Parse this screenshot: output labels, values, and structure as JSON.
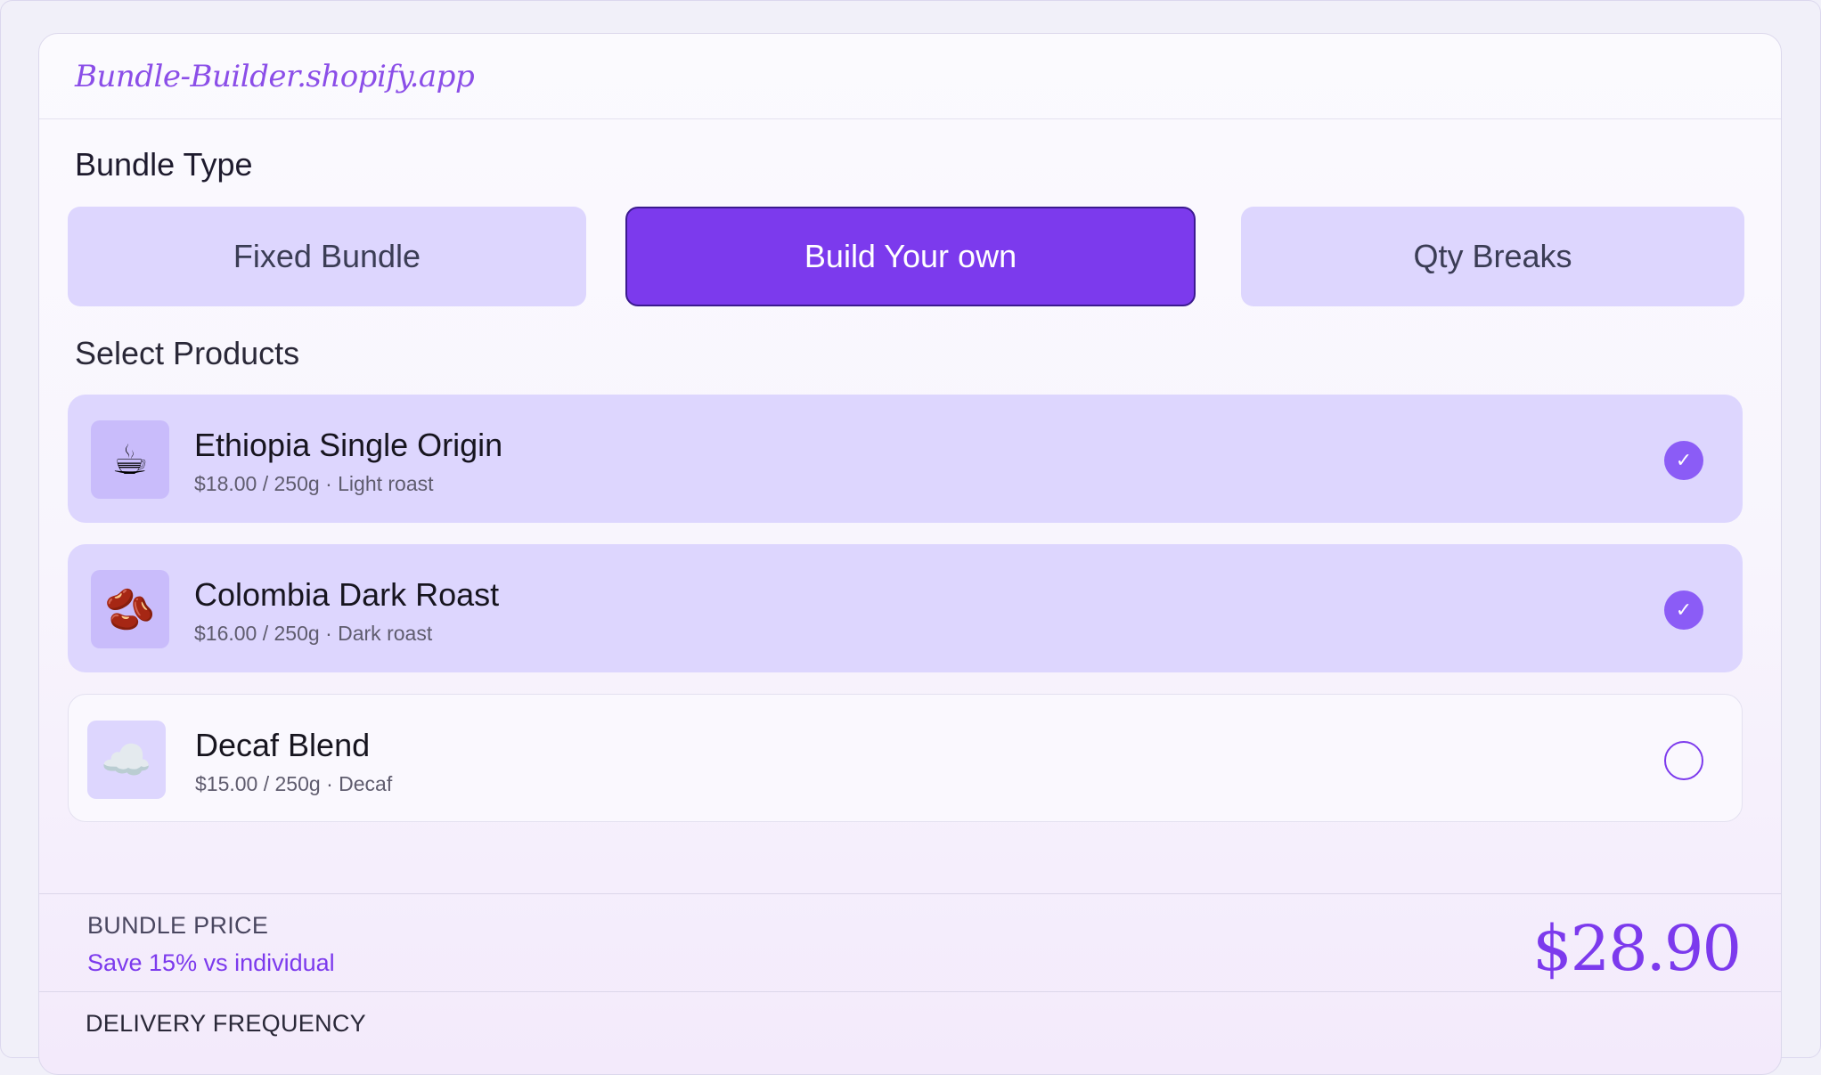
{
  "app": {
    "title": "Bundle-Builder.shopify.app"
  },
  "bundle_type": {
    "label": "Bundle Type",
    "options": [
      {
        "label": "Fixed Bundle",
        "selected": false
      },
      {
        "label": "Build Your own",
        "selected": true
      },
      {
        "label": "Qty Breaks",
        "selected": false
      }
    ]
  },
  "products": {
    "label": "Select Products",
    "items": [
      {
        "icon": "coffee-cup-icon",
        "glyph": "☕",
        "name": "Ethiopia Single Origin",
        "meta": "$18.00 / 250g · Light roast",
        "selected": true
      },
      {
        "icon": "beans-icon",
        "glyph": "🫘",
        "name": "Colombia Dark Roast",
        "meta": "$16.00 / 250g · Dark roast",
        "selected": true
      },
      {
        "icon": "cloud-icon",
        "glyph": "☁️",
        "name": "Decaf Blend",
        "meta": "$15.00 / 250g · Decaf",
        "selected": false
      }
    ]
  },
  "summary": {
    "price_label": "BUNDLE PRICE",
    "savings": "Save 15% vs individual",
    "price": "$28.90",
    "delivery_label": "DELIVERY FREQUENCY"
  },
  "colors": {
    "accent": "#7c3aed",
    "accent_light": "#ddd6fe",
    "check": "#8b5cf6"
  }
}
